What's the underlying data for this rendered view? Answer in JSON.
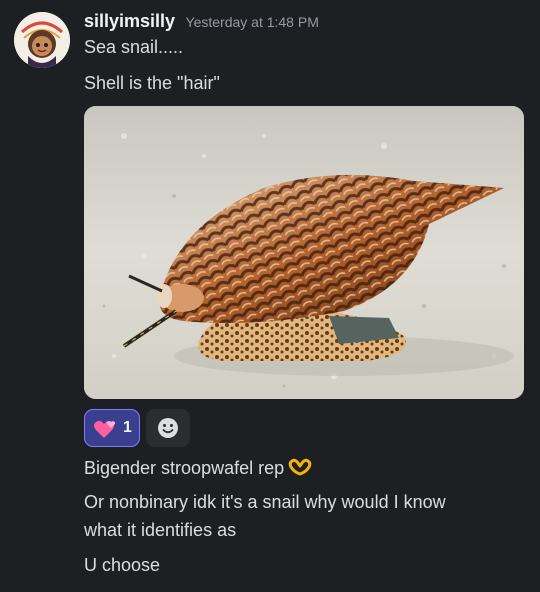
{
  "message": {
    "username": "sillyimsilly",
    "timestamp": "Yesterday at 1:48 PM",
    "avatar_icon": "avatar-icon",
    "lines": [
      "Sea snail.....",
      "Shell is the \"hair\""
    ],
    "attachment_icon": "image-sea-snail",
    "reactions": [
      {
        "emoji": "two-hearts-emoji",
        "count": "1",
        "active": true
      }
    ],
    "add_reaction_icon": "add-reaction-smiley-icon",
    "followup": [
      "Bigender stroopwafel rep",
      "Or nonbinary idk it's a snail why would I know",
      "what it identifies as",
      "U choose"
    ],
    "followup_emoji": "heart-hands-emoji"
  },
  "colors": {
    "background": "#1e1f23",
    "username": "#f2f3f5",
    "text": "#dbdee1",
    "timestamp": "#949ba4",
    "reaction_bg": "#3b3f8f",
    "reaction_border": "#7680ff"
  }
}
